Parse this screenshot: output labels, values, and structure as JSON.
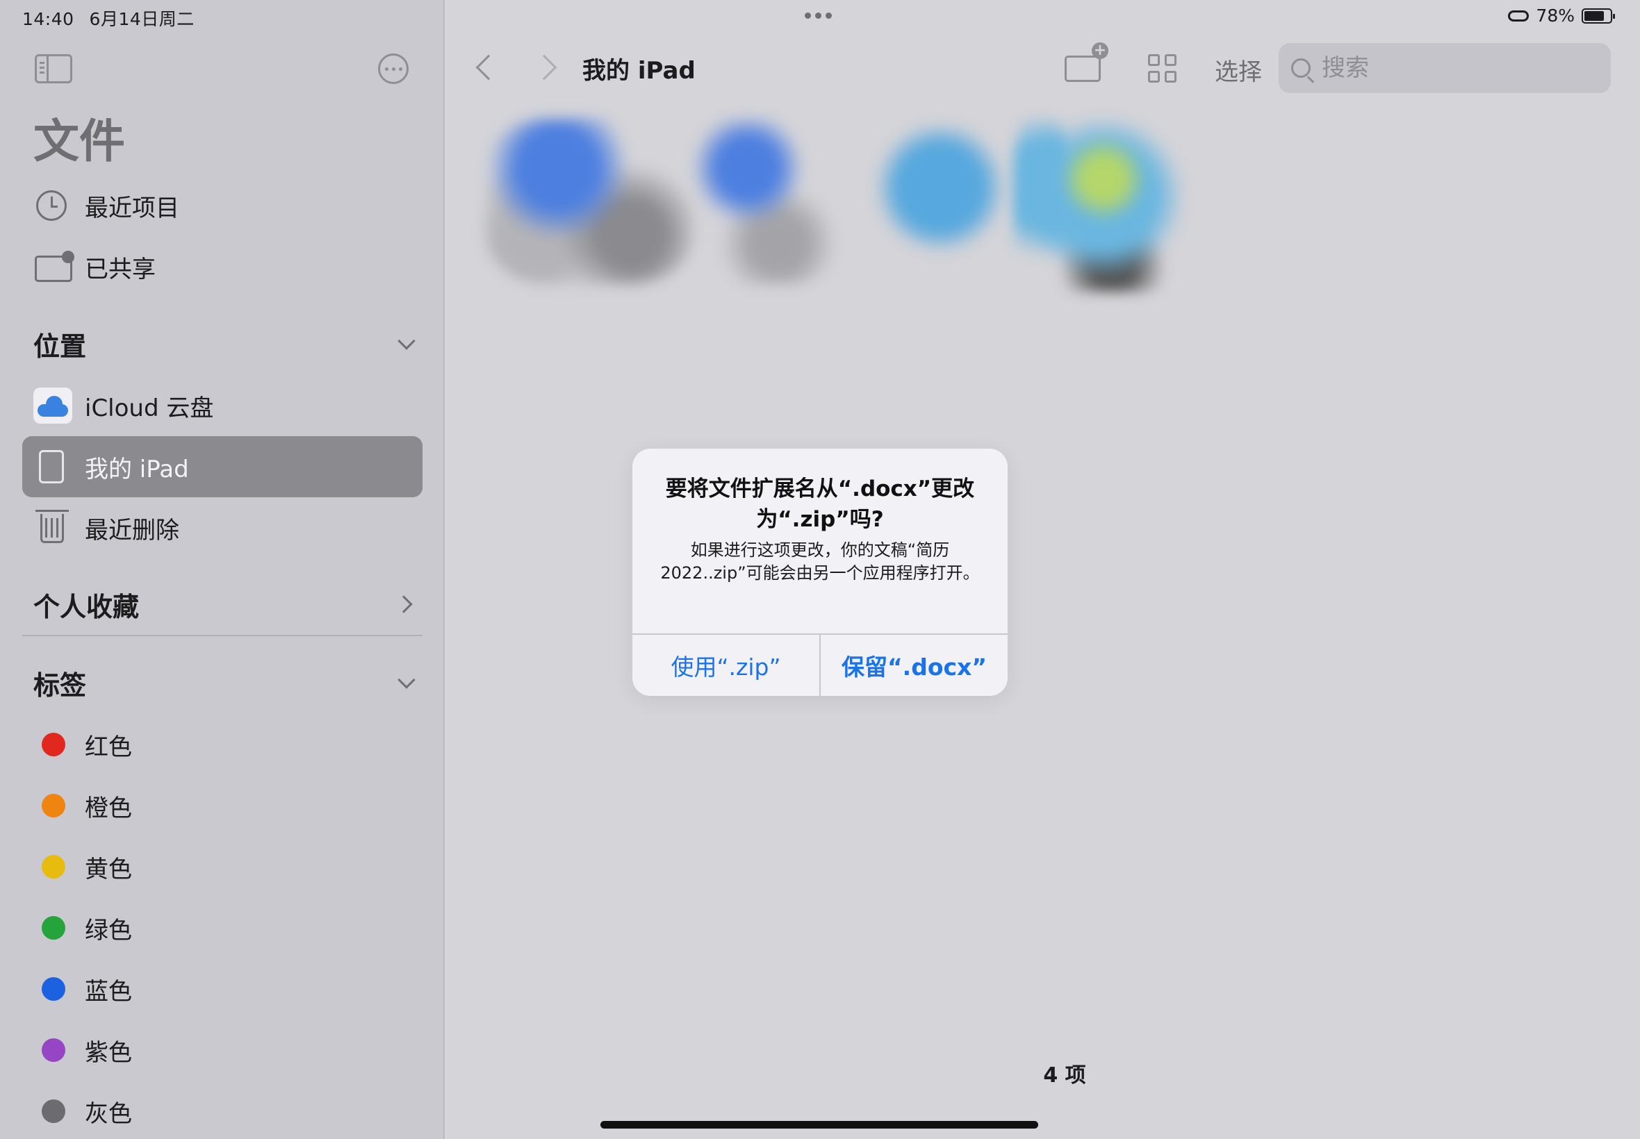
{
  "status": {
    "time": "14:40",
    "date": "6月14日周二",
    "battery": "78%",
    "battery_level": 0.78
  },
  "sidebar": {
    "title": "文件",
    "quick": [
      {
        "label": "最近项目",
        "icon": "clock-icon"
      },
      {
        "label": "已共享",
        "icon": "shared-folder-icon"
      }
    ],
    "locations": {
      "header": "位置",
      "items": [
        {
          "label": "iCloud 云盘",
          "icon": "icloud-icon"
        },
        {
          "label": "我的 iPad",
          "icon": "ipad-icon",
          "selected": true
        },
        {
          "label": "最近删除",
          "icon": "trash-icon"
        }
      ]
    },
    "favorites": {
      "header": "个人收藏"
    },
    "tags": {
      "header": "标签",
      "items": [
        {
          "label": "红色",
          "color": "#e0281f"
        },
        {
          "label": "橙色",
          "color": "#ef8410"
        },
        {
          "label": "黄色",
          "color": "#e8bc0e"
        },
        {
          "label": "绿色",
          "color": "#24a43a"
        },
        {
          "label": "蓝色",
          "color": "#1c62e0"
        },
        {
          "label": "紫色",
          "color": "#9646c4"
        },
        {
          "label": "灰色",
          "color": "#6b6b70"
        }
      ]
    }
  },
  "toolbar": {
    "location_title": "我的 iPad",
    "select_label": "选择",
    "search_placeholder": "搜索"
  },
  "content": {
    "item_count": "4 项"
  },
  "alert": {
    "title": "要将文件扩展名从“.docx”更改为“.zip”吗?",
    "message": "如果进行这项更改，你的文稿“简历2022..zip”可能会由另一个应用程序打开。",
    "use_button": "使用“.zip”",
    "keep_button": "保留“.docx”",
    "accent_color": "#1a73e8"
  }
}
